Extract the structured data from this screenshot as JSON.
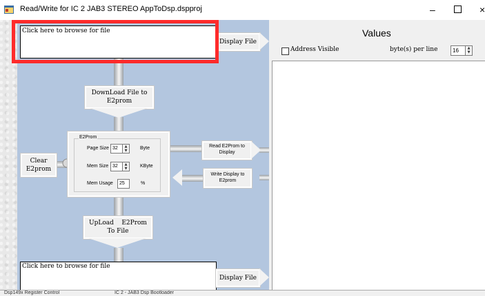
{
  "window": {
    "title": "Read/Write for IC 2 JAB3 STEREO AppToDsp.dspproj",
    "minimize_glyph": "–",
    "close_glyph": "×"
  },
  "top_file": {
    "path_text": "Click here to browse for file",
    "display_button": "Display File"
  },
  "download": {
    "label": "DownLoad File to E2prom"
  },
  "clear": {
    "label": "Clear E2prom"
  },
  "e2prom": {
    "group_title": "E2Prom",
    "page_size_label": "Page Size",
    "page_size_value": "32",
    "page_size_unit": "Byte",
    "mem_size_label": "Mem Size",
    "mem_size_value": "32",
    "mem_size_unit": "KByte",
    "mem_usage_label": "Mem Usage",
    "mem_usage_value": "25",
    "mem_usage_unit": "%"
  },
  "read_button": "Read E2Prom to Display",
  "write_button": "Write Display to E2prom",
  "upload": {
    "label": "UpLoad    E2Prom To File"
  },
  "bottom_file": {
    "path_text": "Click here to browse for file",
    "display_button": "Display File"
  },
  "values": {
    "title": "Values",
    "address_visible_label": "Address Visible",
    "address_visible_checked": false,
    "bytes_per_line_label": "byte(s) per line",
    "bytes_per_line_value": "16"
  },
  "status_tabs": [
    "Dsp149x Register Control",
    "IC 2 - JAB3 Dsp Bootloader"
  ],
  "colors": {
    "flow_background": "#b3c6df",
    "highlight": "#ff2b2b"
  },
  "icons": {
    "app": "app-window-icon",
    "maximize": "maximize-icon"
  }
}
